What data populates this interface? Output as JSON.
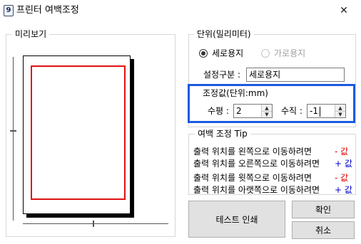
{
  "window": {
    "title": "프린터 여백조정",
    "app_icon_glyph": "9",
    "close_glyph": "✕"
  },
  "preview": {
    "legend": "미리보기"
  },
  "unit": {
    "legend": "단위(밀리미터)",
    "options": [
      {
        "label": "세로용지",
        "selected": true,
        "enabled": true
      },
      {
        "label": "가로용지",
        "selected": false,
        "enabled": false
      }
    ],
    "setting_label": "설정구분 :",
    "setting_value": "세로용지"
  },
  "adjust": {
    "legend": "조정값(단위:mm)",
    "horizontal_label": "수평 :",
    "horizontal_value": "2",
    "vertical_label": "수직 :",
    "vertical_value": "-1",
    "highlight_color": "#1a5ae0"
  },
  "tip": {
    "legend": "여백 조정 Tip",
    "lines": [
      {
        "text": "출력 위치를 왼쪽으로 이동하려면",
        "sign": "- 값",
        "color": "#e00000"
      },
      {
        "text": "출력 위치를 오른쪽으로 이동하려면",
        "sign": "+ 값",
        "color": "#0000d0"
      },
      {
        "text": "출력 위치를 윗쪽으로 이동하려면",
        "sign": "- 값",
        "color": "#e00000"
      },
      {
        "text": "출력 위치를 아랫쪽으로 이동하려면",
        "sign": "+ 값",
        "color": "#0000d0"
      }
    ]
  },
  "buttons": {
    "test_print": "테스트 인쇄",
    "ok": "확인",
    "cancel": "취소"
  }
}
